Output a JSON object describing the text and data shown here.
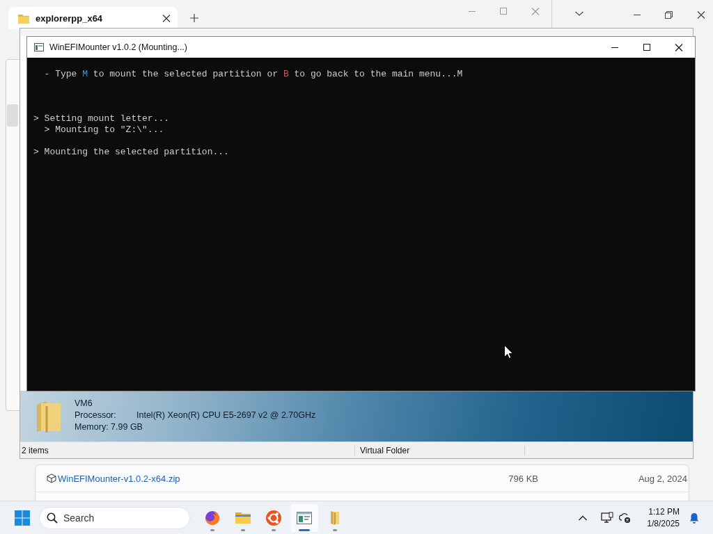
{
  "browser": {
    "tab_title": "explorerpp_x64"
  },
  "terminal": {
    "title": "WinEFIMounter v1.0.2 (Mounting...)",
    "lines": [
      {
        "kind": "text",
        "segments": [
          {
            "text": "  - Type "
          },
          {
            "text": "M",
            "color": "#3a96dd"
          },
          {
            "text": " to mount the selected partition or "
          },
          {
            "text": "B",
            "color": "#e74856"
          },
          {
            "text": " to go back to the main menu...M"
          }
        ]
      },
      {
        "kind": "blank"
      },
      {
        "kind": "blank"
      },
      {
        "kind": "blank"
      },
      {
        "kind": "text",
        "segments": [
          {
            "text": "> Setting mount letter..."
          }
        ]
      },
      {
        "kind": "text",
        "segments": [
          {
            "text": "  > Mounting to \"Z:\\\"..."
          }
        ]
      },
      {
        "kind": "blank"
      },
      {
        "kind": "text",
        "segments": [
          {
            "text": "> Mounting the selected partition..."
          }
        ]
      }
    ]
  },
  "explorer": {
    "details": {
      "name": "VM6",
      "fields": [
        {
          "kind": "tabbed",
          "label": "Processor:",
          "value": "Intel(R) Xeon(R) CPU E5-2697 v2 @ 2.70GHz"
        },
        {
          "kind": "inline",
          "label": "Memory:",
          "value": "7.99 GB"
        }
      ]
    },
    "status_bar": [
      "2 items",
      "Virtual Folder"
    ]
  },
  "file_list": {
    "rows": [
      {
        "name": "WinEFIMounter-v1.0.2-x64.zip",
        "size": "796 KB",
        "date": "Aug 2, 2024"
      }
    ]
  },
  "taskbar": {
    "search_placeholder": "Search",
    "apps": [
      {
        "kind": "firefox",
        "selected": false
      },
      {
        "kind": "files",
        "selected": false
      },
      {
        "kind": "ubuntu",
        "selected": false
      },
      {
        "kind": "console",
        "selected": true
      },
      {
        "kind": "folder",
        "selected": false
      }
    ],
    "clock": {
      "time": "1:12 PM",
      "date": "1/8/2025"
    }
  }
}
